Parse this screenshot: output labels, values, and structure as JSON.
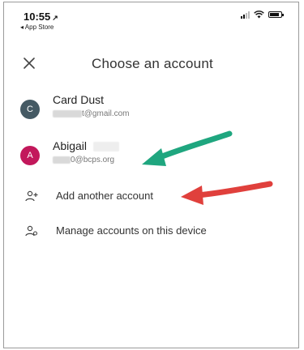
{
  "status_bar": {
    "time": "10:55",
    "back_label": "◂ App Store"
  },
  "header": {
    "title": "Choose an account",
    "close_icon": "close-icon"
  },
  "accounts": [
    {
      "name": "Card Dust",
      "initial": "C",
      "email_suffix": "t@gmail.com",
      "avatar_color": "#455a64"
    },
    {
      "name": "Abigail",
      "initial": "A",
      "email_suffix": "0@bcps.org",
      "avatar_color": "#c2185b"
    }
  ],
  "actions": [
    {
      "label": "Add another account",
      "icon": "add-person-icon"
    },
    {
      "label": "Manage accounts on this device",
      "icon": "manage-accounts-icon"
    }
  ],
  "annotations": {
    "green_arrow_color": "#1fa67f",
    "red_arrow_color": "#e0403c"
  }
}
